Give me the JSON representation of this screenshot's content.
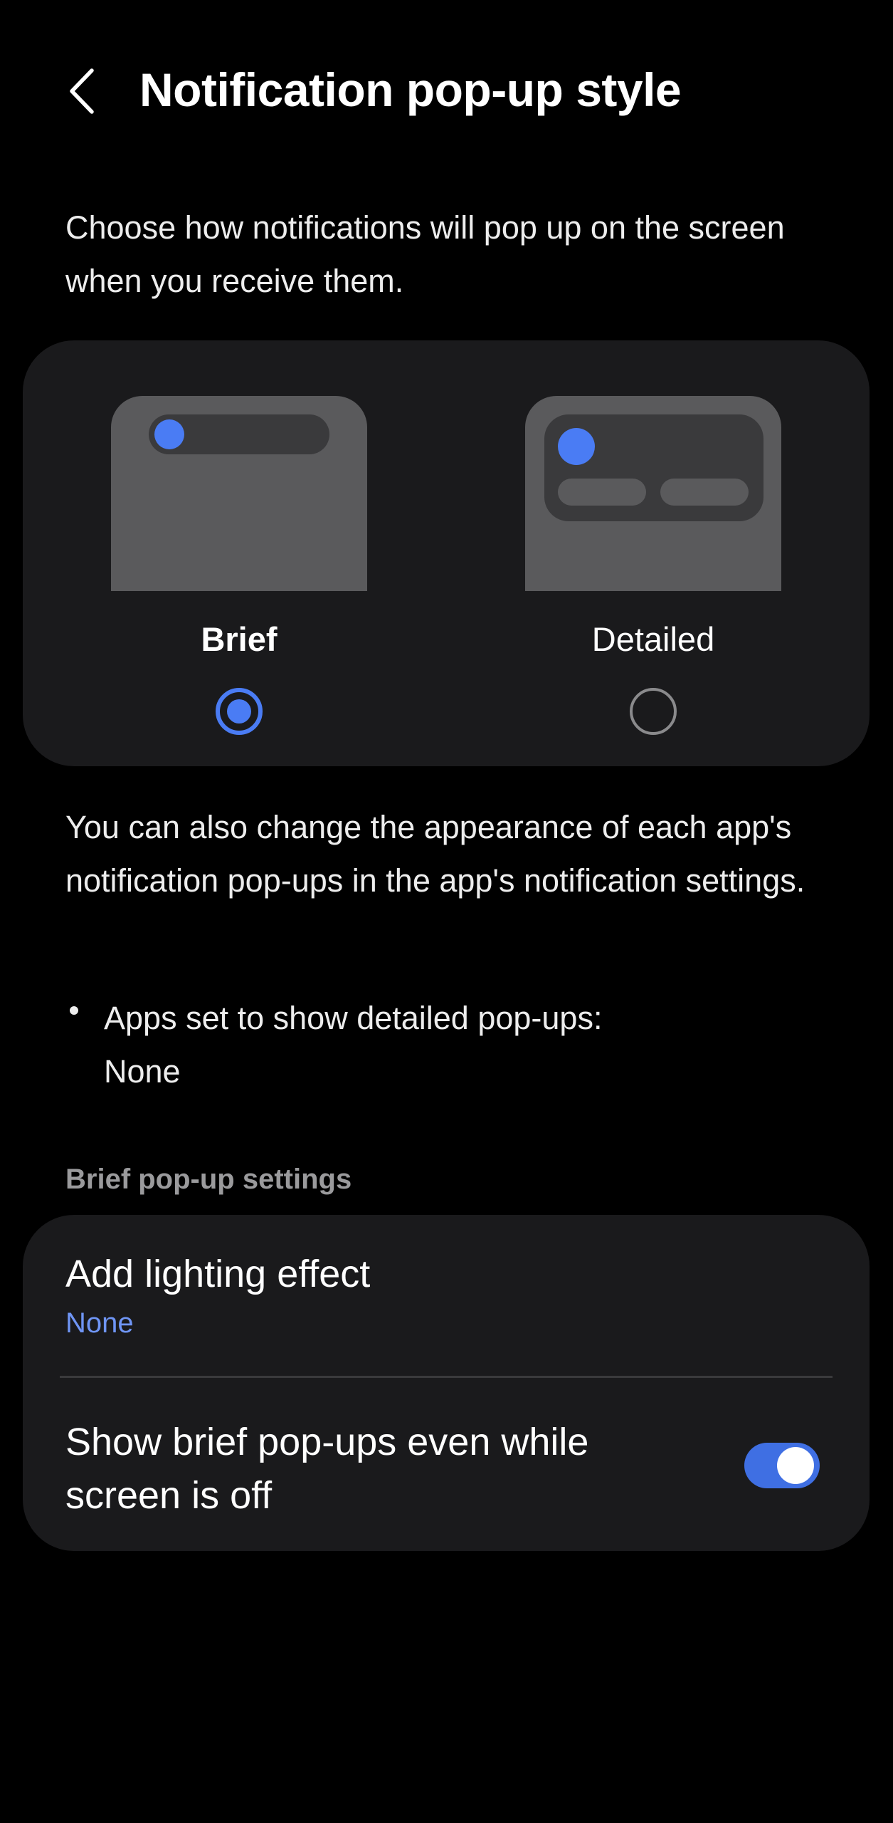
{
  "header": {
    "title": "Notification pop-up style",
    "back_icon": "chevron-left-icon"
  },
  "intro": "Choose how notifications will pop up on the screen when you receive them.",
  "style_chooser": {
    "selected": "Brief",
    "options": [
      {
        "label": "Brief",
        "selected": true
      },
      {
        "label": "Detailed",
        "selected": false
      }
    ]
  },
  "info_text": "You can also change the appearance of each app's notification pop-ups in the app's notification settings.",
  "bullet": {
    "label": "Apps set to show detailed pop-ups:",
    "value": "None"
  },
  "brief_settings": {
    "section_title": "Brief pop-up settings",
    "lighting_effect": {
      "title": "Add lighting effect",
      "value": "None"
    },
    "screen_off": {
      "title": "Show brief pop-ups even while screen is off",
      "enabled": true
    }
  },
  "colors": {
    "accent": "#4a7cf4",
    "card_bg": "#1a1a1c",
    "background": "#000000",
    "secondary_text": "#9a9a9c",
    "link_text": "#6f95f5"
  }
}
